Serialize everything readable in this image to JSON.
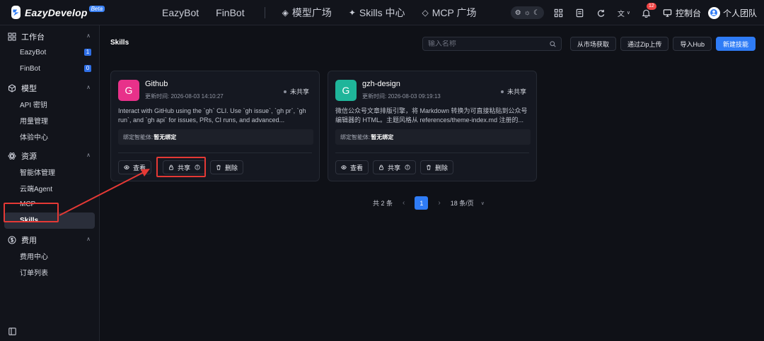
{
  "header": {
    "brand": "EazyDevelop",
    "beta": "Beta",
    "nav": [
      "EazyBot",
      "FinBot"
    ],
    "nav2": [
      {
        "glyph": "◈",
        "label": "模型广场"
      },
      {
        "glyph": "✦",
        "label": "Skills 中心"
      },
      {
        "glyph": "◇",
        "label": "MCP 广场"
      }
    ],
    "notifications": "12",
    "lang": "文",
    "console": "控制台",
    "team": "个人团队"
  },
  "sidebar": {
    "groups": [
      {
        "label": "工作台",
        "icon": "grid-icon",
        "items": [
          {
            "label": "EazyBot",
            "count": "1"
          },
          {
            "label": "FinBot",
            "count": "0"
          }
        ]
      },
      {
        "label": "模型",
        "icon": "cube-icon",
        "items": [
          {
            "label": "API 密钥"
          },
          {
            "label": "用量管理"
          },
          {
            "label": "体验中心"
          }
        ]
      },
      {
        "label": "资源",
        "icon": "atom-icon",
        "items": [
          {
            "label": "智能体管理"
          },
          {
            "label": "云端Agent"
          },
          {
            "label": "MCP"
          },
          {
            "label": "Skills"
          }
        ]
      },
      {
        "label": "费用",
        "icon": "dollar-icon",
        "items": [
          {
            "label": "费用中心"
          },
          {
            "label": "订单列表"
          }
        ]
      }
    ]
  },
  "main": {
    "title": "Skills",
    "search_placeholder": "输入名称",
    "buttons": {
      "market": "从市场获取",
      "zip": "通过Zip上传",
      "hub": "导入Hub",
      "create": "新建技能"
    },
    "cards": [
      {
        "initial": "G",
        "color": "#e8318a",
        "name": "Github",
        "time_label": "更新时间:",
        "time": "2026-08-03 14:10:27",
        "status": "未共享",
        "desc": "Interact with GitHub using the `gh` CLI. Use `gh issue`, `gh pr`, `gh run`, and `gh api` for issues, PRs, CI runs, and advanced...",
        "bind_label": "绑定智能体:",
        "bind_value": "暂无绑定",
        "ops": {
          "view": "查看",
          "share": "共享",
          "delete": "删除"
        }
      },
      {
        "initial": "G",
        "color": "#1fb59a",
        "name": "gzh-design",
        "time_label": "更新时间:",
        "time": "2026-08-03 09:19:13",
        "status": "未共享",
        "desc": "微信公众号文章排版引擎，将 Markdown 转换为可直接粘贴到公众号编辑器的 HTML。主题风格从 references/theme-index.md 注册的...",
        "bind_label": "绑定智能体:",
        "bind_value": "暂无绑定",
        "ops": {
          "view": "查看",
          "share": "共享",
          "delete": "删除"
        }
      }
    ],
    "pager": {
      "total": "共 2 条",
      "current": "1",
      "size": "18 条/页"
    }
  }
}
